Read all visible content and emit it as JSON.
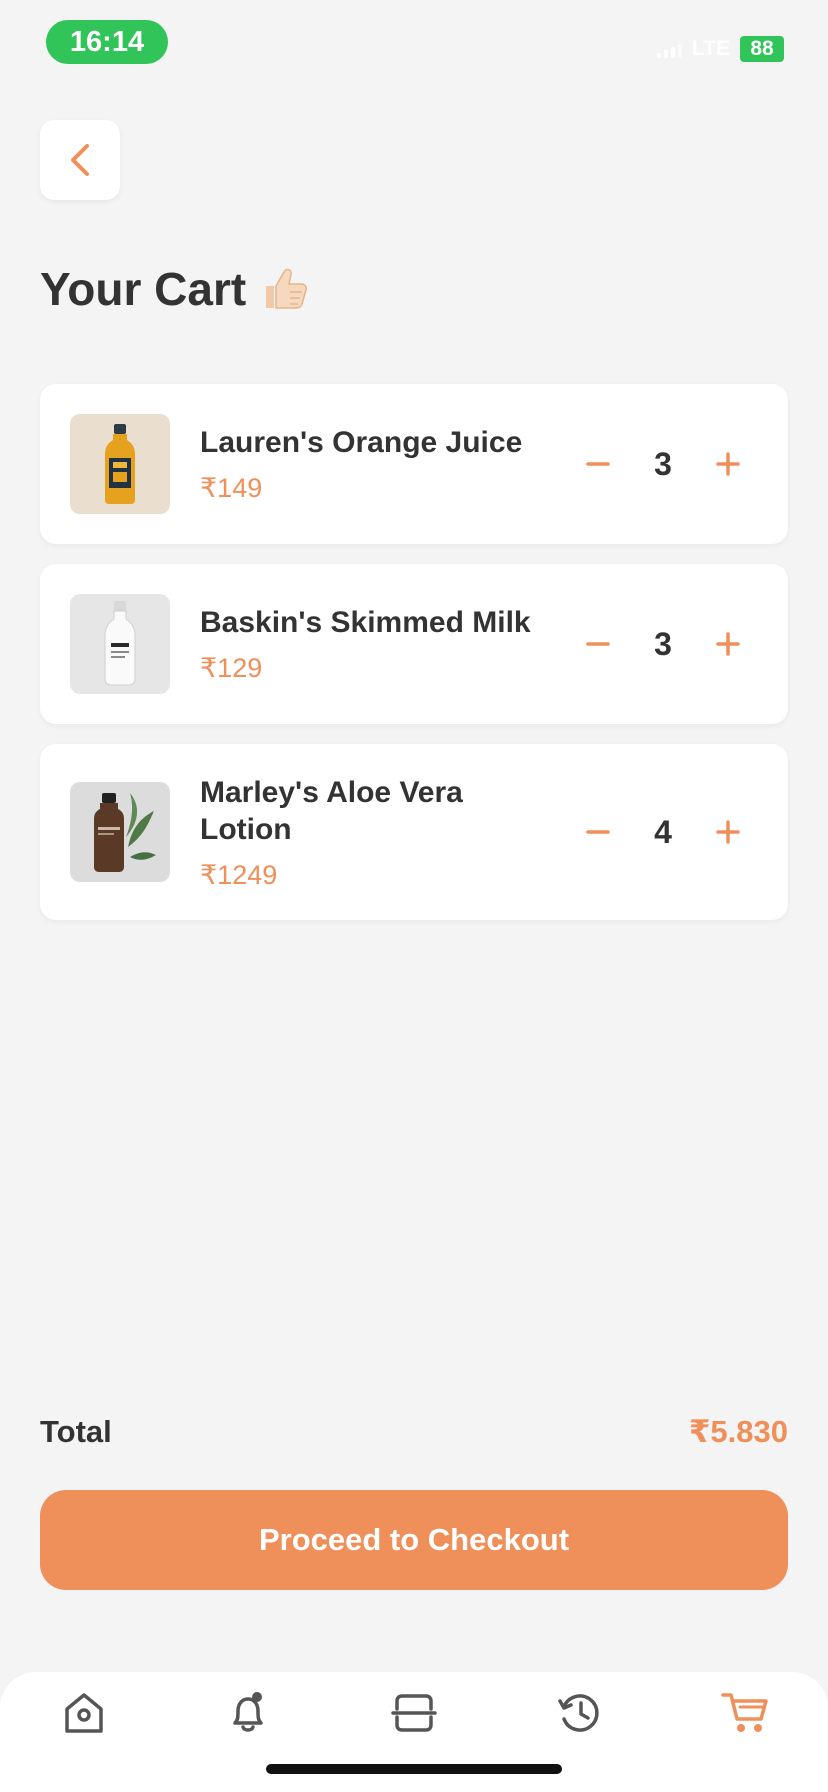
{
  "status_bar": {
    "time": "16:14",
    "network": "LTE",
    "battery": "88"
  },
  "page": {
    "title": "Your Cart"
  },
  "cart": {
    "items": [
      {
        "name": "Lauren's Orange Juice",
        "price": "₹149",
        "quantity": "3"
      },
      {
        "name": "Baskin's Skimmed Milk",
        "price": "₹129",
        "quantity": "3"
      },
      {
        "name": "Marley's Aloe Vera Lotion",
        "price": "₹1249",
        "quantity": "4"
      }
    ]
  },
  "summary": {
    "total_label": "Total",
    "total_value": "₹5.830"
  },
  "checkout": {
    "label": "Proceed to Checkout"
  },
  "tabs": [
    {
      "icon": "home-icon",
      "active": false
    },
    {
      "icon": "bell-icon",
      "active": false
    },
    {
      "icon": "scan-icon",
      "active": false
    },
    {
      "icon": "history-icon",
      "active": false
    },
    {
      "icon": "cart-icon",
      "active": true
    }
  ],
  "colors": {
    "accent": "#ef8f5a",
    "background": "#f4f4f4",
    "card": "#ffffff",
    "status_green": "#30c459",
    "text": "#333333"
  }
}
